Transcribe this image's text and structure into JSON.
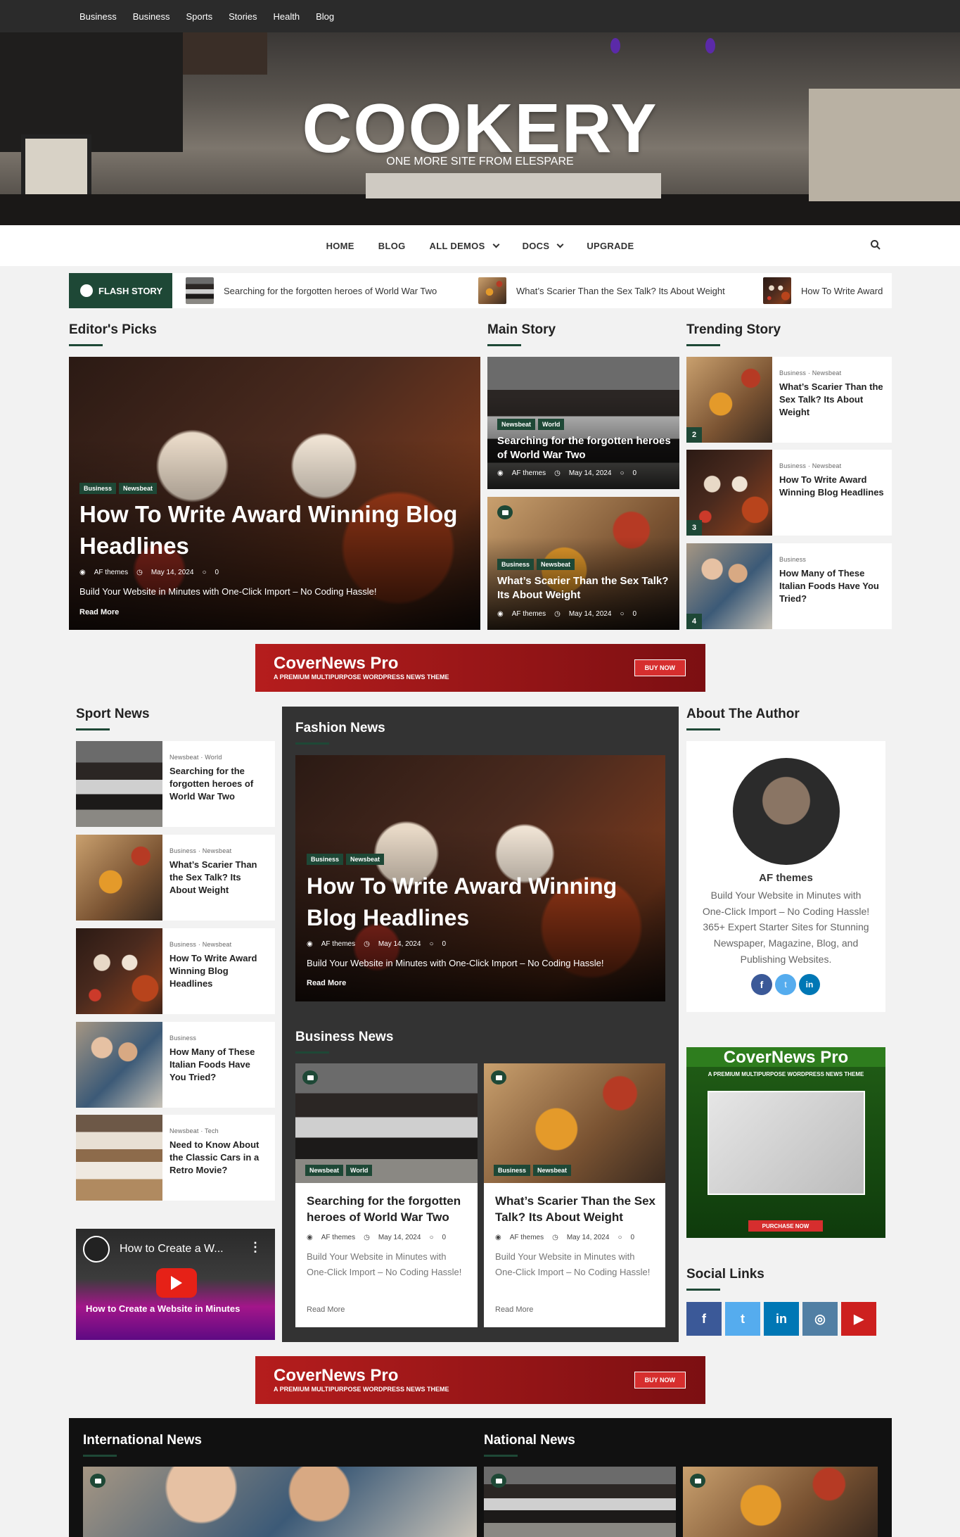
{
  "topbar": {
    "items": [
      "Business",
      "Business",
      "Sports",
      "Stories",
      "Health",
      "Blog"
    ]
  },
  "site": {
    "title": "COOKERY",
    "tagline": "ONE MORE SITE FROM ELESPARE"
  },
  "nav": {
    "items": [
      "HOME",
      "BLOG",
      "ALL DEMOS",
      "DOCS",
      "UPGRADE"
    ]
  },
  "flash": {
    "label": "FLASH STORY",
    "items": [
      "Searching for the forgotten heroes of World War Two",
      "What’s Scarier Than the Sex Talk? Its About Weight",
      "How To Write Award"
    ]
  },
  "editors": {
    "title": "Editor's Picks",
    "tags": [
      "Business",
      "Newsbeat"
    ],
    "headline": "How To Write Award Winning Blog Headlines",
    "author": "AF themes",
    "date": "May 14, 2024",
    "comments": "0",
    "excerpt": "Build Your Website in Minutes with One-Click Import – No Coding Hassle!",
    "readmore": "Read More"
  },
  "main_story": {
    "title": "Main Story",
    "items": [
      {
        "tags": [
          "Newsbeat",
          "World"
        ],
        "headline": "Searching for the forgotten heroes of World War Two",
        "author": "AF themes",
        "date": "May 14, 2024",
        "comments": "0"
      },
      {
        "tags": [
          "Business",
          "Newsbeat"
        ],
        "headline": "What’s Scarier Than the Sex Talk? Its About Weight",
        "author": "AF themes",
        "date": "May 14, 2024",
        "comments": "0"
      }
    ]
  },
  "trending": {
    "title": "Trending Story",
    "items": [
      {
        "cats": "Business ·  Newsbeat",
        "headline": "What’s Scarier Than the Sex Talk? Its About Weight",
        "num": "2"
      },
      {
        "cats": "Business ·  Newsbeat",
        "headline": "How To Write Award Winning Blog Headlines",
        "num": "3"
      },
      {
        "cats": "Business",
        "headline": "How Many of These Italian Foods Have You Tried?",
        "num": "4"
      }
    ]
  },
  "banner": {
    "title": "CoverNews Pro",
    "subtitle": "A PREMIUM MULTIPURPOSE WORDPRESS NEWS THEME",
    "button": "BUY NOW"
  },
  "sport": {
    "title": "Sport News",
    "items": [
      {
        "cats": "Newsbeat ·  World",
        "headline": "Searching for the forgotten heroes of World War Two"
      },
      {
        "cats": "Business ·  Newsbeat",
        "headline": "What’s Scarier Than the Sex Talk? Its About Weight"
      },
      {
        "cats": "Business ·  Newsbeat",
        "headline": "How To Write Award Winning Blog Headlines"
      },
      {
        "cats": "Business",
        "headline": "How Many of These Italian Foods Have You Tried?"
      },
      {
        "cats": "Newsbeat ·  Tech",
        "headline": "Need to Know About the Classic Cars in a Retro Movie?"
      }
    ]
  },
  "video": {
    "title": "How to Create a W...",
    "overlay": "How to Create a Website in Minutes"
  },
  "fashion": {
    "title": "Fashion News",
    "tags": [
      "Business",
      "Newsbeat"
    ],
    "headline": "How To Write Award Winning Blog Headlines",
    "author": "AF themes",
    "date": "May 14, 2024",
    "comments": "0",
    "excerpt": "Build Your Website in Minutes with One-Click Import – No Coding Hassle!",
    "readmore": "Read More"
  },
  "business": {
    "title": "Business News",
    "items": [
      {
        "tags": [
          "Newsbeat",
          "World"
        ],
        "headline": "Searching for the forgotten heroes of World War Two",
        "author": "AF themes",
        "date": "May 14, 2024",
        "comments": "0",
        "excerpt": "Build Your Website in Minutes with One-Click Import – No Coding Hassle!",
        "readmore": "Read More"
      },
      {
        "tags": [
          "Business",
          "Newsbeat"
        ],
        "headline": "What’s Scarier Than the Sex Talk? Its About Weight",
        "author": "AF themes",
        "date": "May 14, 2024",
        "comments": "0",
        "excerpt": "Build Your Website in Minutes with One-Click Import – No Coding Hassle!",
        "readmore": "Read More"
      }
    ]
  },
  "author": {
    "title": "About The Author",
    "name": "AF themes",
    "bio": "Build Your Website in Minutes with One-Click Import – No Coding Hassle! 365+ Expert Starter Sites for Stunning Newspaper, Magazine, Blog, and Publishing Websites."
  },
  "side_ad": {
    "title": "CoverNews Pro",
    "subtitle": "A PREMIUM MULTIPURPOSE WORDPRESS NEWS THEME",
    "button": "PURCHASE NOW"
  },
  "social": {
    "title": "Social Links",
    "colors": [
      "#3b5998",
      "#55acee",
      "#0077b5",
      "#517fa4",
      "#cd201f"
    ]
  },
  "international": {
    "title": "International News"
  },
  "national": {
    "title": "National News"
  }
}
